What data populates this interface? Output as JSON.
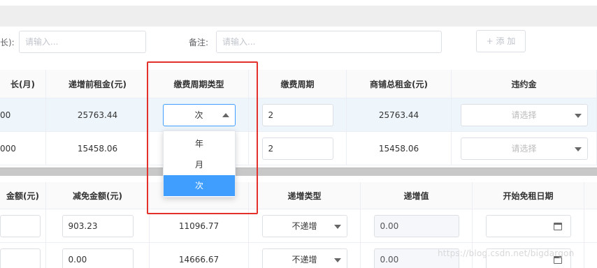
{
  "form": {
    "left_label_fragment": "长):",
    "left_input_placeholder": "请输入...",
    "remark_label": "备注:",
    "remark_input_placeholder": "请输入...",
    "add_button": "+ 添 加"
  },
  "table1": {
    "headers": [
      "长(月)",
      "递增前租金(元)",
      "缴费周期类型",
      "缴费周期",
      "商铺总租金(元)",
      "违约金"
    ],
    "rows": [
      {
        "c0": "00",
        "c1": "25763.44",
        "period_type": "次",
        "period": "2",
        "total": "25763.44",
        "penalty_placeholder": "请选择"
      },
      {
        "c0": "000",
        "c1": "15458.06",
        "period_type": "",
        "period": "2",
        "total": "15458.06",
        "penalty_placeholder": "请选择"
      }
    ]
  },
  "dropdown": {
    "options": [
      "年",
      "月",
      "次"
    ],
    "selected": "次"
  },
  "table2": {
    "headers": [
      "金额(元)",
      "减免金额(元)",
      "",
      "递增类型",
      "递增值",
      "开始免租日期"
    ],
    "rows": [
      {
        "c0": "",
        "discount": "903.23",
        "amount": "11096.77",
        "inc_type": "不递增",
        "inc_value": "0.00"
      },
      {
        "c0": "",
        "discount": "0.00",
        "amount": "14666.67",
        "inc_type": "不递增",
        "inc_value": "0.00"
      }
    ]
  },
  "watermark": "https://blog.csdn.net/bigdargon",
  "colors": {
    "accent": "#409eff",
    "highlight_box": "#e4302b",
    "selected_row": "#eef6fc"
  }
}
